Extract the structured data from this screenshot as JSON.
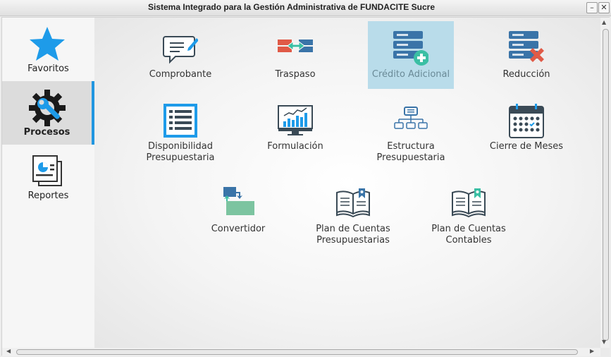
{
  "window": {
    "title": "Sistema Integrado para la Gestión Administrativa de FUNDACITE Sucre",
    "minimize_glyph": "–",
    "close_glyph": "✕"
  },
  "sidebar": {
    "items": [
      {
        "label": "Favoritos",
        "icon": "star-icon",
        "active": false
      },
      {
        "label": "Procesos",
        "icon": "gear-wrench-icon",
        "active": true
      },
      {
        "label": "Reportes",
        "icon": "reports-icon",
        "active": false
      }
    ]
  },
  "main": {
    "tiles": [
      {
        "label": "Comprobante",
        "icon": "comment-edit-icon"
      },
      {
        "label": "Traspaso",
        "icon": "transfer-icon"
      },
      {
        "label": "Crédito Adicional",
        "icon": "database-add-icon",
        "selected": true
      },
      {
        "label": "Reducción",
        "icon": "database-remove-icon"
      },
      {
        "label": "Disponibilidad\nPresupuestaria",
        "icon": "list-document-icon"
      },
      {
        "label": "Formulación",
        "icon": "chart-monitor-icon"
      },
      {
        "label": "Estructura\nPresupuestaria",
        "icon": "hierarchy-icon"
      },
      {
        "label": "Cierre de Meses",
        "icon": "calendar-icon"
      },
      {
        "label": "Convertidor",
        "icon": "convert-icon"
      },
      {
        "label": "Plan de Cuentas\nPresupuestarias",
        "icon": "book-blue-bookmark-icon"
      },
      {
        "label": "Plan de Cuentas\nContables",
        "icon": "book-green-bookmark-icon"
      }
    ]
  },
  "colors": {
    "accent": "#2196e0",
    "selected_tile": "#b9dcea",
    "star": "#1e9be9",
    "teal": "#3bbfa4",
    "red": "#e05a47",
    "slate": "#3a5f7d"
  }
}
